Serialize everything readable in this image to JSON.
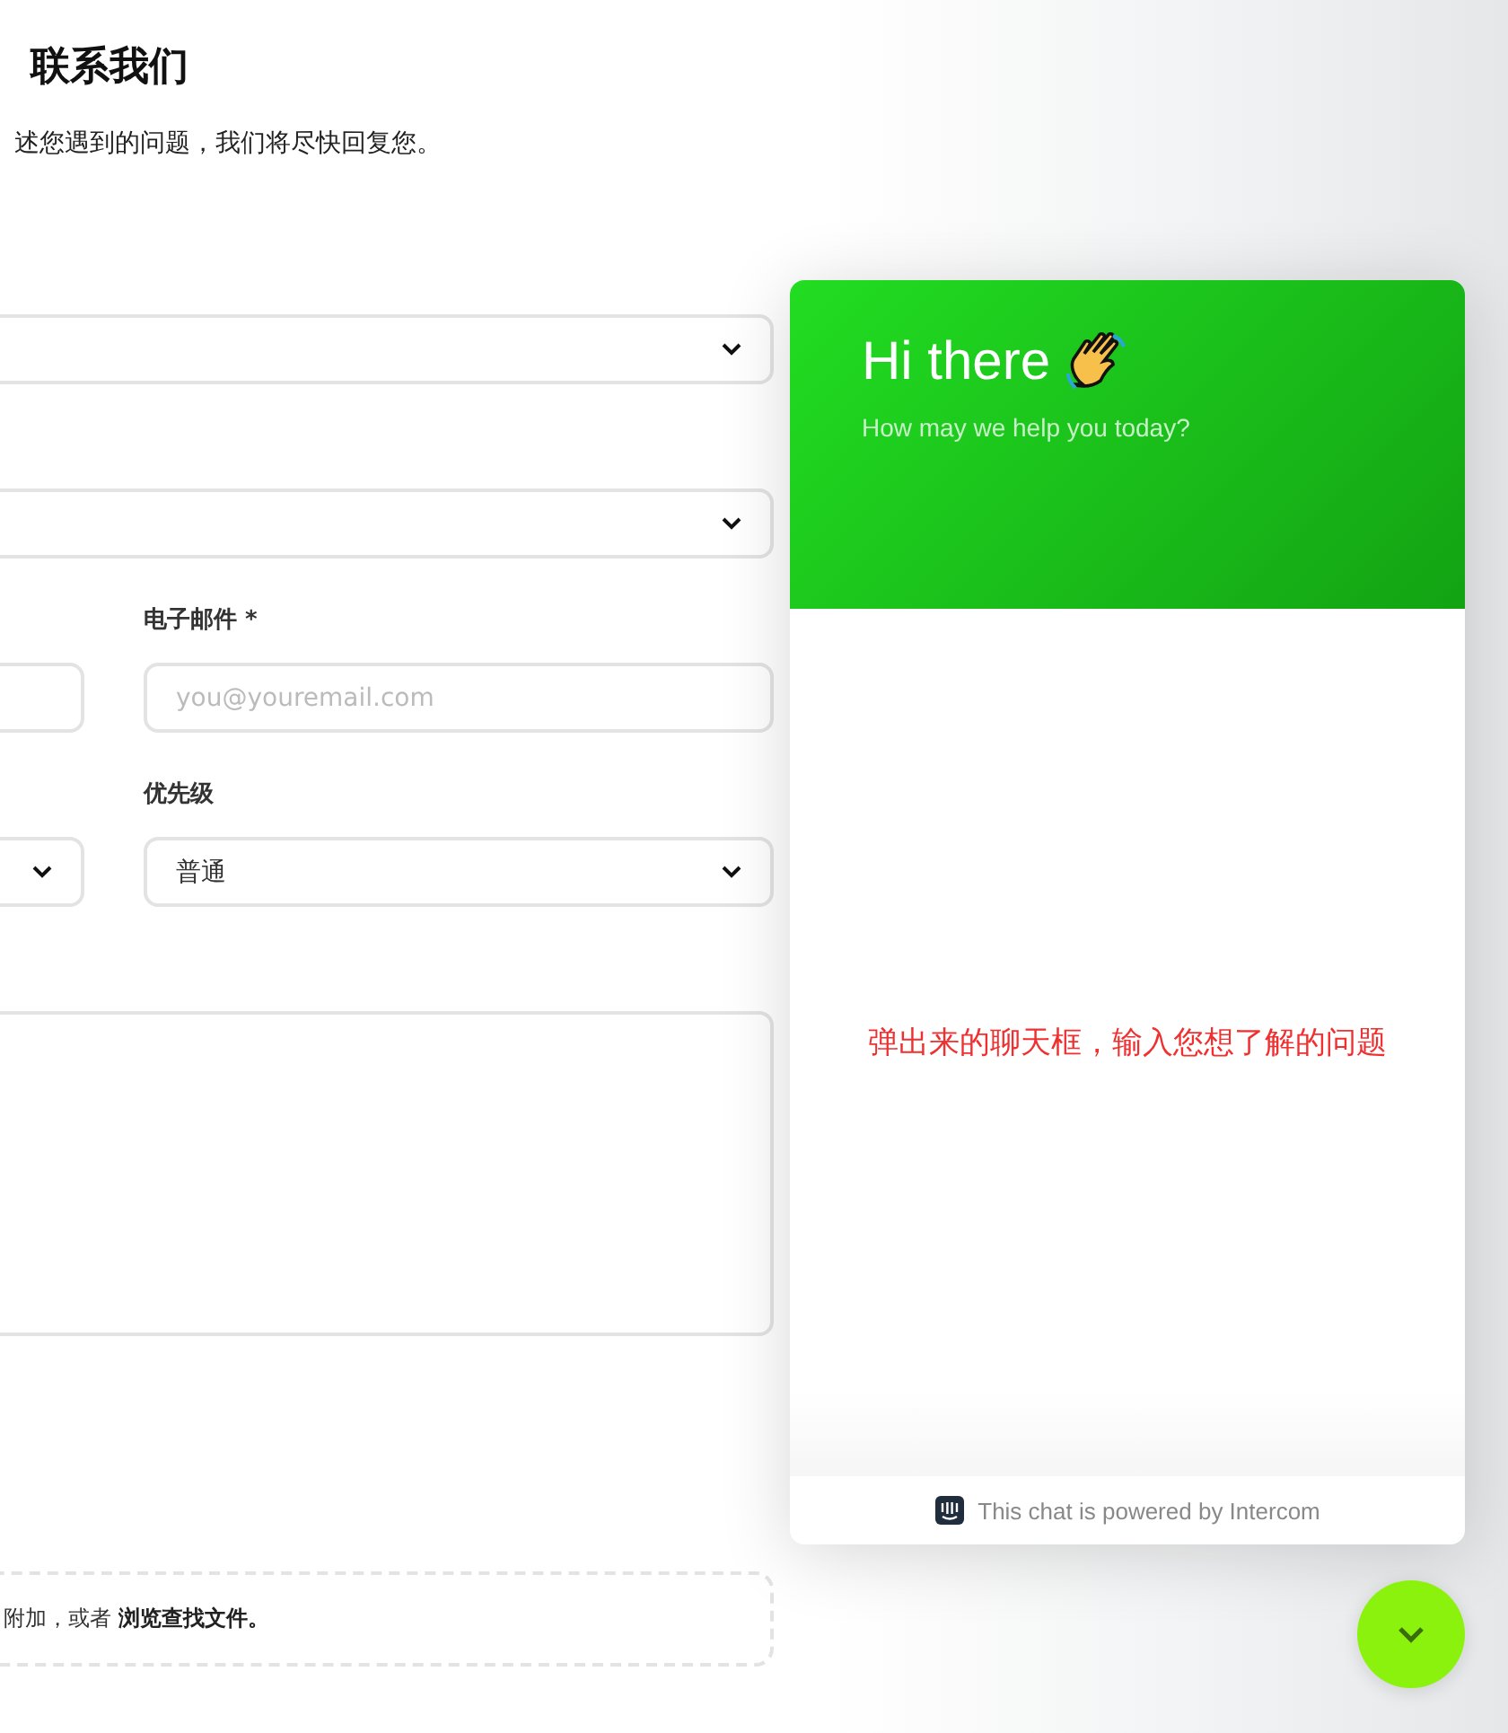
{
  "page": {
    "title": "联系我们",
    "subtitle": "述您遇到的问题，我们将尽快回复您。"
  },
  "form": {
    "rows": [
      [
        {
          "kind": "select"
        }
      ],
      [
        {
          "kind": "select"
        }
      ],
      [
        {
          "kind": "input"
        },
        {
          "kind": "input",
          "label": "电子邮件 *",
          "placeholder": "you@youremail.com"
        }
      ],
      [
        {
          "kind": "select"
        },
        {
          "kind": "select",
          "label": "优先级",
          "value": "普通"
        }
      ],
      [
        {
          "kind": "textarea"
        }
      ]
    ],
    "dropzone": {
      "text": "附加，或者 ",
      "link": "浏览查找文件。"
    }
  },
  "chat": {
    "greeting": "Hi there",
    "subtitle": "How may we help you today?",
    "note": "弹出来的聊天框，输入您想了解的问题",
    "footer": "This chat is powered by Intercom"
  }
}
